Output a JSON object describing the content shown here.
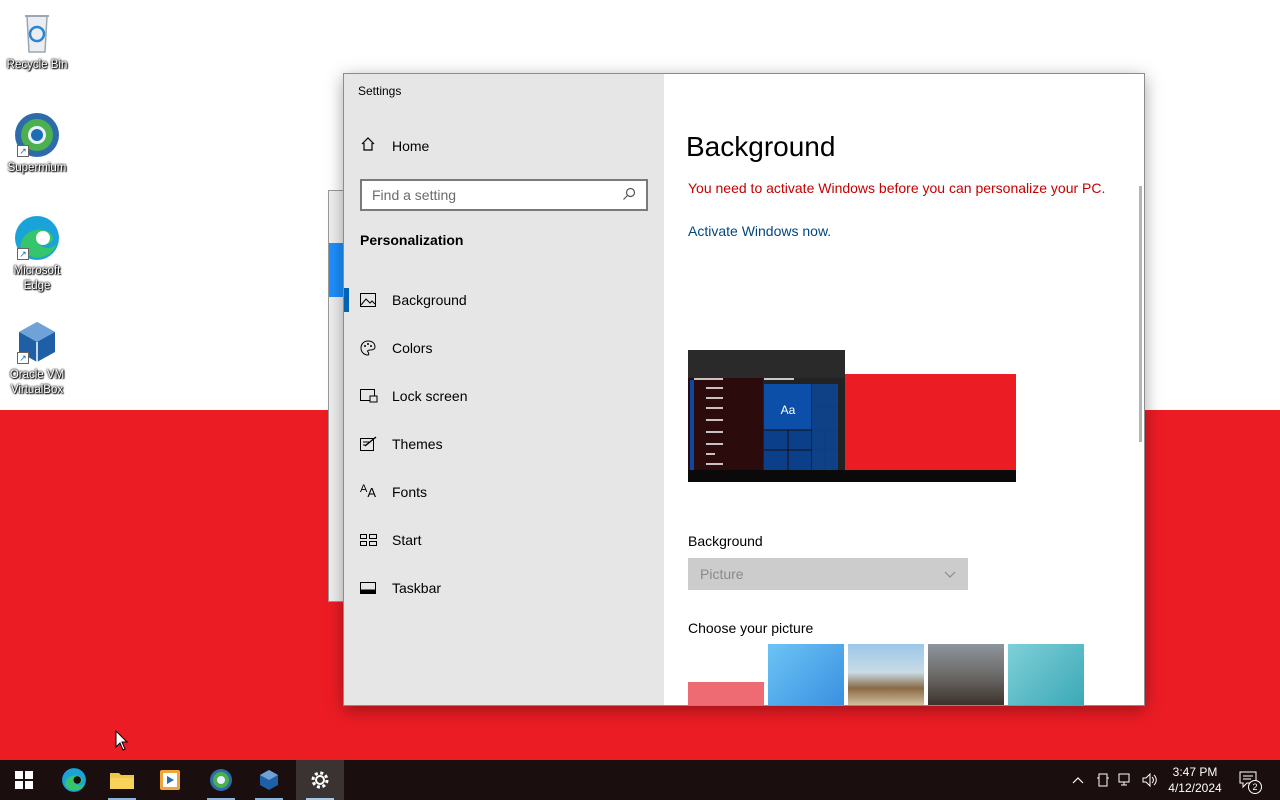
{
  "desktop": {
    "icons": [
      {
        "label": "Recycle Bin",
        "icon": "recycle-bin-icon"
      },
      {
        "label": "Supermium",
        "icon": "supermium-icon"
      },
      {
        "label": "Microsoft Edge",
        "icon": "edge-icon"
      },
      {
        "label": "Oracle VM VirtualBox",
        "icon": "virtualbox-icon"
      }
    ],
    "colors": {
      "top": "#ffffff",
      "bottom": "#ec1c24"
    }
  },
  "settings": {
    "title": "Settings",
    "nav": {
      "home": "Home",
      "search_placeholder": "Find a setting",
      "section": "Personalization",
      "items": [
        {
          "label": "Background",
          "icon": "picture-icon",
          "selected": true
        },
        {
          "label": "Colors",
          "icon": "palette-icon"
        },
        {
          "label": "Lock screen",
          "icon": "lock-screen-icon"
        },
        {
          "label": "Themes",
          "icon": "themes-icon"
        },
        {
          "label": "Fonts",
          "icon": "fonts-icon"
        },
        {
          "label": "Start",
          "icon": "start-icon"
        },
        {
          "label": "Taskbar",
          "icon": "taskbar-icon"
        }
      ]
    },
    "content": {
      "title": "Background",
      "warning": "You need to activate Windows before you can personalize your PC.",
      "activate_link": "Activate Windows now.",
      "preview_sample": "Aa",
      "background_label": "Background",
      "background_value": "Picture",
      "choose_label": "Choose your picture"
    },
    "colors": {
      "accent": "#0063b1",
      "warning": "#c50000",
      "link": "#00467f"
    }
  },
  "taskbar": {
    "apps": [
      {
        "name": "start",
        "icon": "windows-logo-icon"
      },
      {
        "name": "edge",
        "icon": "edge-icon"
      },
      {
        "name": "file-explorer",
        "icon": "folder-icon"
      },
      {
        "name": "media",
        "icon": "media-player-icon"
      },
      {
        "name": "supermium",
        "icon": "supermium-icon"
      },
      {
        "name": "virtualbox",
        "icon": "virtualbox-icon"
      },
      {
        "name": "settings",
        "icon": "gear-icon",
        "active": true
      }
    ],
    "time": "3:47 PM",
    "date": "4/12/2024",
    "notifications": "2"
  }
}
